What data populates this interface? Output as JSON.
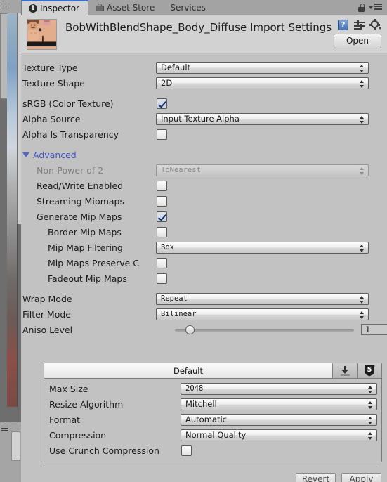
{
  "window": {
    "tabs": [
      {
        "label": "Inspector",
        "icon": "info-icon",
        "active": true
      },
      {
        "label": "Asset Store",
        "icon": "store-icon",
        "active": false
      },
      {
        "label": "Services",
        "icon": "",
        "active": false
      }
    ],
    "lock_icon": "lock-icon",
    "menu_icon": "panel-menu-icon"
  },
  "header": {
    "title": "BobWithBlendShape_Body_Diffuse Import Settings",
    "thumbnail": "texture-thumbnail",
    "help_icon": "help-icon",
    "help_glyph": "?",
    "preset_icon": "preset-icon",
    "gear_icon": "gear-icon",
    "open_label": "Open"
  },
  "settings": {
    "texture_type": {
      "label": "Texture Type",
      "value": "Default"
    },
    "texture_shape": {
      "label": "Texture Shape",
      "value": "2D"
    },
    "srgb": {
      "label": "sRGB (Color Texture)",
      "checked": true
    },
    "alpha_source": {
      "label": "Alpha Source",
      "value": "Input Texture Alpha"
    },
    "alpha_is_transparency": {
      "label": "Alpha Is Transparency",
      "checked": false
    }
  },
  "advanced": {
    "label": "Advanced",
    "expanded": true,
    "non_power_of_2": {
      "label": "Non-Power of 2",
      "value": "ToNearest",
      "disabled": true
    },
    "read_write": {
      "label": "Read/Write Enabled",
      "checked": false
    },
    "streaming_mipmaps": {
      "label": "Streaming Mipmaps",
      "checked": false
    },
    "generate_mip_maps": {
      "label": "Generate Mip Maps",
      "checked": true
    },
    "border_mip_maps": {
      "label": "Border Mip Maps",
      "checked": false
    },
    "mip_map_filtering": {
      "label": "Mip Map Filtering",
      "value": "Box"
    },
    "mip_maps_preserve_coverage": {
      "label": "Mip Maps Preserve Co",
      "checked": false
    },
    "fadeout_mip_maps": {
      "label": "Fadeout Mip Maps",
      "checked": false
    }
  },
  "sampling": {
    "wrap_mode": {
      "label": "Wrap Mode",
      "value": "Repeat"
    },
    "filter_mode": {
      "label": "Filter Mode",
      "value": "Bilinear"
    },
    "aniso_level": {
      "label": "Aniso Level",
      "value": "1",
      "percent": 6
    }
  },
  "platform": {
    "tabs": [
      {
        "label": "Default",
        "icon": "",
        "active": true
      },
      {
        "label": "",
        "icon": "standalone-download-icon",
        "active": false
      },
      {
        "label": "",
        "icon": "html5-webgl-icon",
        "active": false
      }
    ],
    "html5_glyph": "5",
    "max_size": {
      "label": "Max Size",
      "value": "2048"
    },
    "resize_algorithm": {
      "label": "Resize Algorithm",
      "value": "Mitchell"
    },
    "format": {
      "label": "Format",
      "value": "Automatic"
    },
    "compression": {
      "label": "Compression",
      "value": "Normal Quality"
    },
    "use_crunch_compression": {
      "label": "Use Crunch Compression",
      "checked": false
    }
  },
  "footer": {
    "revert_label": "Revert",
    "apply_label": "Apply"
  },
  "colors": {
    "background": "#c2c2c2",
    "header_bg": "#d2d2d2",
    "tab_active_accent": "#3a6fc4",
    "foldout_blue": "#3f55c4",
    "check_blue": "#13306f"
  }
}
